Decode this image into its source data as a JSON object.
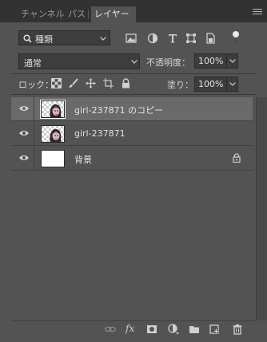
{
  "tabs": [
    {
      "label": "チャンネル",
      "active": false
    },
    {
      "label": "パス",
      "active": false
    },
    {
      "label": "レイヤー",
      "active": true
    }
  ],
  "filter": {
    "kind_label": "種類",
    "icons": [
      "image-filter-icon",
      "adjustment-filter-icon",
      "type-filter-icon",
      "shape-filter-icon",
      "smart-object-filter-icon"
    ]
  },
  "blend": {
    "mode": "通常",
    "opacity_label": "不透明度：",
    "opacity_value": "100%"
  },
  "lock": {
    "label": "ロック：",
    "fill_label": "塗り：",
    "fill_value": "100%"
  },
  "layers": [
    {
      "name": "girl-237871 のコピー",
      "selected": true,
      "visible": true,
      "thumb": "photo"
    },
    {
      "name": "girl-237871",
      "selected": false,
      "visible": true,
      "thumb": "photo"
    },
    {
      "name": "背景",
      "selected": false,
      "visible": true,
      "thumb": "white",
      "locked": true
    }
  ],
  "bottom_icons": [
    "link-icon",
    "fx-icon",
    "mask-icon",
    "adjustment-layer-icon",
    "group-folder-icon",
    "new-layer-icon",
    "trash-icon"
  ],
  "bottom_fx_label": "fx",
  "colors": {
    "panel": "#535353",
    "tabbar": "#323232",
    "selected_row": "#6a6a6a",
    "field": "#3d3d3d"
  }
}
